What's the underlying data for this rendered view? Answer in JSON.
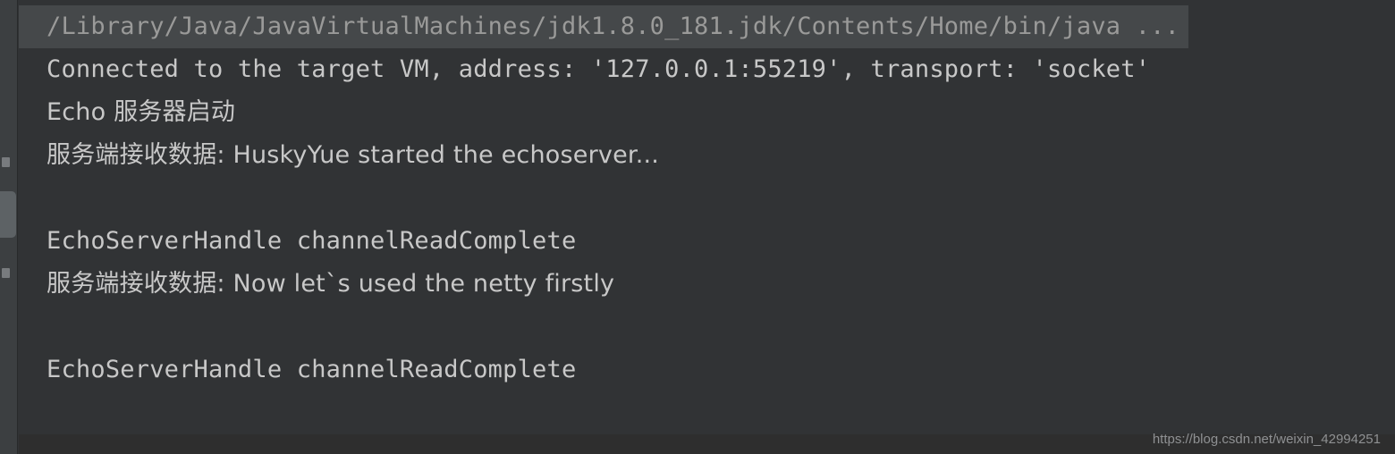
{
  "window": {
    "background_color": "#313335",
    "gutter_color": "#3c3f41",
    "tab_indicator_color": "#4a88c7",
    "highlight_color": "#45484a",
    "text_color": "#c8c8c8"
  },
  "gutter": {
    "items": [
      {
        "name": "tool-window-button-upper",
        "label": ""
      },
      {
        "name": "tool-window-button-active",
        "label": ""
      },
      {
        "name": "tool-window-button-lower",
        "label": ""
      }
    ]
  },
  "console": {
    "lines": [
      {
        "id": "command-line",
        "kind": "command",
        "text": "/Library/Java/JavaVirtualMachines/jdk1.8.0_181.jdk/Contents/Home/bin/java ..."
      },
      {
        "id": "connected-line",
        "kind": "output",
        "text": "Connected to the target VM, address: '127.0.0.1:55219', transport: 'socket'"
      },
      {
        "id": "echo-start-line",
        "kind": "output",
        "text": "Echo 服务器启动"
      },
      {
        "id": "server-received-1",
        "kind": "output",
        "text": "服务端接收数据: HuskyYue started the echoserver..."
      },
      {
        "id": "blank-1",
        "kind": "blank",
        "text": ""
      },
      {
        "id": "channel-read-complete-1",
        "kind": "output",
        "text": "EchoServerHandle channelReadComplete"
      },
      {
        "id": "server-received-2",
        "kind": "output",
        "text": "服务端接收数据: Now let`s used the netty firstly"
      },
      {
        "id": "blank-2",
        "kind": "blank",
        "text": ""
      },
      {
        "id": "channel-read-complete-2",
        "kind": "output",
        "text": "EchoServerHandle channelReadComplete"
      }
    ]
  },
  "watermark": {
    "text": "https://blog.csdn.net/weixin_42994251"
  }
}
